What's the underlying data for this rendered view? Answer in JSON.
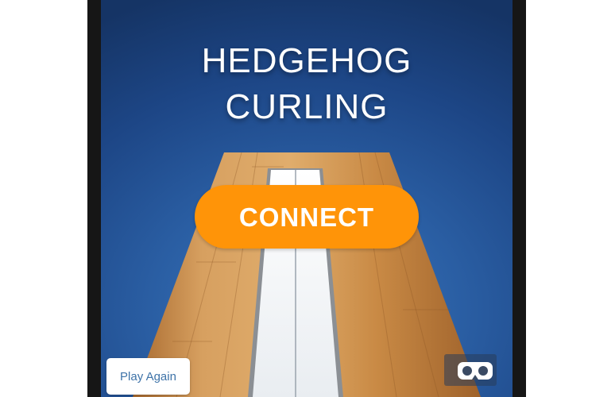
{
  "game": {
    "title_line1": "HEDGEHOG",
    "title_line2": "CURLING",
    "connect_label": "CONNECT",
    "play_again_label": "Play Again",
    "vr_icon": "vr-headset-icon"
  },
  "colors": {
    "accent_orange": "#ff9408",
    "background_blue": "#2a5ea3",
    "play_again_text": "#3e73a8",
    "wood": "#c98a45",
    "ice": "#eef0f2"
  }
}
